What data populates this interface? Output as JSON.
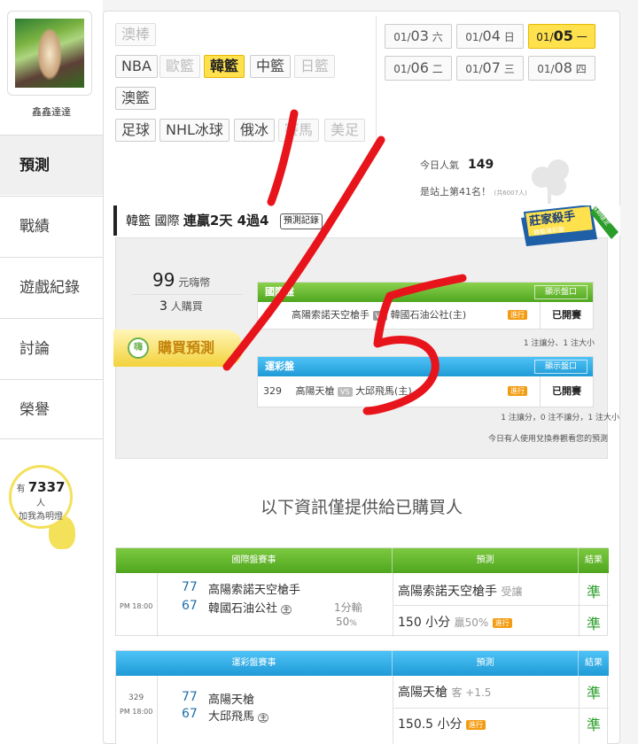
{
  "user": {
    "name": "鑫鑫達達"
  },
  "nav": {
    "items": [
      "預測",
      "戰績",
      "遊戲紀錄",
      "討論",
      "榮譽"
    ]
  },
  "fans": {
    "prefix": "有",
    "count": "7337",
    "suffix": "人",
    "cta": "加我為明燈"
  },
  "sports": {
    "row1": [
      "澳棒"
    ],
    "row2": [
      "NBA",
      "歐籃",
      "韓籃",
      "中籃",
      "日籃"
    ],
    "row3": [
      "澳籃"
    ],
    "row4": [
      "足球",
      "NHL冰球",
      "俄冰",
      "賽馬",
      "美足"
    ]
  },
  "dates": [
    {
      "md": "01/",
      "d": "03",
      "w": "六"
    },
    {
      "md": "01/",
      "d": "04",
      "w": "日"
    },
    {
      "md": "01/",
      "d": "05",
      "w": "一"
    },
    {
      "md": "01/",
      "d": "06",
      "w": "二"
    },
    {
      "md": "01/",
      "d": "07",
      "w": "三"
    },
    {
      "md": "01/",
      "d": "08",
      "w": "四"
    }
  ],
  "stats": {
    "popularity_label": "今日人氣",
    "popularity": "149",
    "rank_text": "是站上第41名！",
    "rank_small": "(共6007人)"
  },
  "header": {
    "title": "韓籃 國際",
    "streak": "連贏2天 4過4",
    "record_btn": "預測記錄"
  },
  "badge": {
    "line1": "莊家殺手",
    "line2": "韓籃運彩盤",
    "ribbon": "長期穩定"
  },
  "purchase": {
    "price": "99",
    "price_unit": "元嗨幣",
    "buyers": "3",
    "buyers_unit": "人購買",
    "buy_label": "購買預測",
    "buy_icon": "嗨"
  },
  "panel_intl": {
    "title": "國際盤",
    "show_btn": "顯示盤口",
    "home": "高陽索諾天空槍手",
    "vs": "VS",
    "away": "韓國石油公社(主)",
    "live": "進行",
    "status": "已開賽",
    "note": "1 注讓分、1 注大小"
  },
  "panel_sport": {
    "title": "運彩盤",
    "show_btn": "顯示盤口",
    "id": "329",
    "home": "高陽天槍",
    "vs": "VS",
    "away": "大邱飛馬(主)",
    "live": "進行",
    "status": "已開賽",
    "note": "1 注讓分，0 注不讓分，1 注大小"
  },
  "footnote": "今日有人使用兌換券觀看您的預測",
  "info_title": "以下資訊僅提供給已購買人",
  "table_intl": {
    "headers": [
      "國際盤賽事",
      "預測",
      "結果"
    ],
    "time": "PM 18:00",
    "team1_score": "77",
    "team1": "高陽索諾天空槍手",
    "team2_score": "67",
    "team2": "韓國石油公社",
    "home_mark": "主",
    "margin": "1分輸",
    "margin_pct": "50",
    "pred1": "高陽索諾天空槍手",
    "pred1_tag": "受讓",
    "pred2": "150 小分",
    "pred2_tag": "贏50%",
    "live": "進行",
    "res1": "準",
    "res2": "準"
  },
  "table_sport": {
    "headers": [
      "運彩盤賽事",
      "預測",
      "結果"
    ],
    "id": "329",
    "time": "PM 18:00",
    "team1_score": "77",
    "team1": "高陽天槍",
    "team2_score": "67",
    "team2": "大邱飛馬",
    "home_mark": "主",
    "pred1": "高陽天槍",
    "pred1_tag": "客 +1.5",
    "pred2": "150.5 小分",
    "live": "進行",
    "res1": "準",
    "res2": "準"
  },
  "colors": {
    "accent_yellow": "#ffe14d",
    "green_header": "#4fa61e",
    "blue_header": "#1f9ad6",
    "result_green": "#2a9d2a",
    "scribble_red": "#e8141c"
  }
}
